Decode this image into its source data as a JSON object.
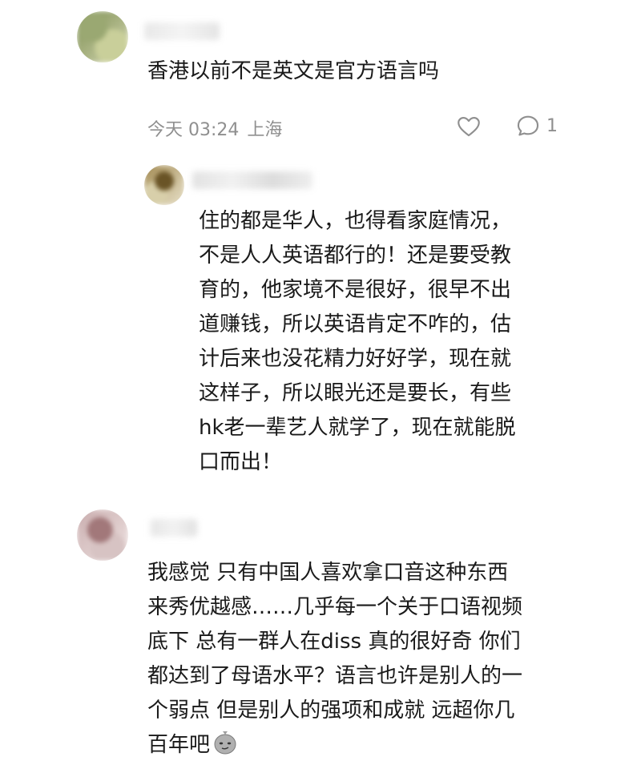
{
  "comments": [
    {
      "text": "香港以前不是英文是官方语言吗",
      "date": "今天 03:24",
      "location": "上海",
      "reply_count": "1",
      "reply": {
        "text": "住的都是华人，也得看家庭情况，\n不是人人英语都行的！还是要受教\n育的，他家境不是很好，很早不出\n道赚钱，所以英语肯定不咋的，估\n计后来也没花精力好好学，现在就\n这样子，所以眼光还是要长，有些\nhk老一辈艺人就学了，现在就能脱\n口而出！"
      }
    },
    {
      "text": "我感觉 只有中国人喜欢拿口音这种东西\n来秀优越感……几乎每一个关于口语视频\n底下 总有一群人在diss 真的很好奇 你们\n都达到了母语水平？语言也许是别人的一\n个弱点 但是别人的强项和成就 远超你几\n百年吧",
      "emoji": "smirk-bag-emoji"
    }
  ],
  "colors": {
    "text": "#1a1a1a",
    "meta": "#8f8f8f"
  }
}
